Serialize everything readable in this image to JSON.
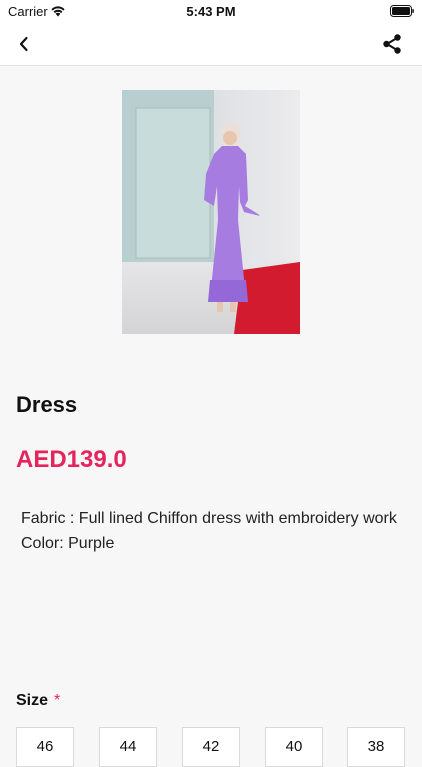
{
  "status_bar": {
    "carrier": "Carrier",
    "time": "5:43 PM"
  },
  "nav": {
    "back_icon": "chevron-left-icon",
    "share_icon": "share-icon"
  },
  "product": {
    "title": "Dress",
    "price": "AED139.0",
    "description": "Fabric : Full lined Chiffon dress with embroidery work\nColor: Purple",
    "image_alt_icon": "product-photo"
  },
  "size_selector": {
    "heading": "Size",
    "required_marker": "*",
    "options": [
      "46",
      "44",
      "42",
      "40",
      "38"
    ]
  },
  "colors": {
    "accent": "#e5245e",
    "dress": "#a67ce0"
  }
}
